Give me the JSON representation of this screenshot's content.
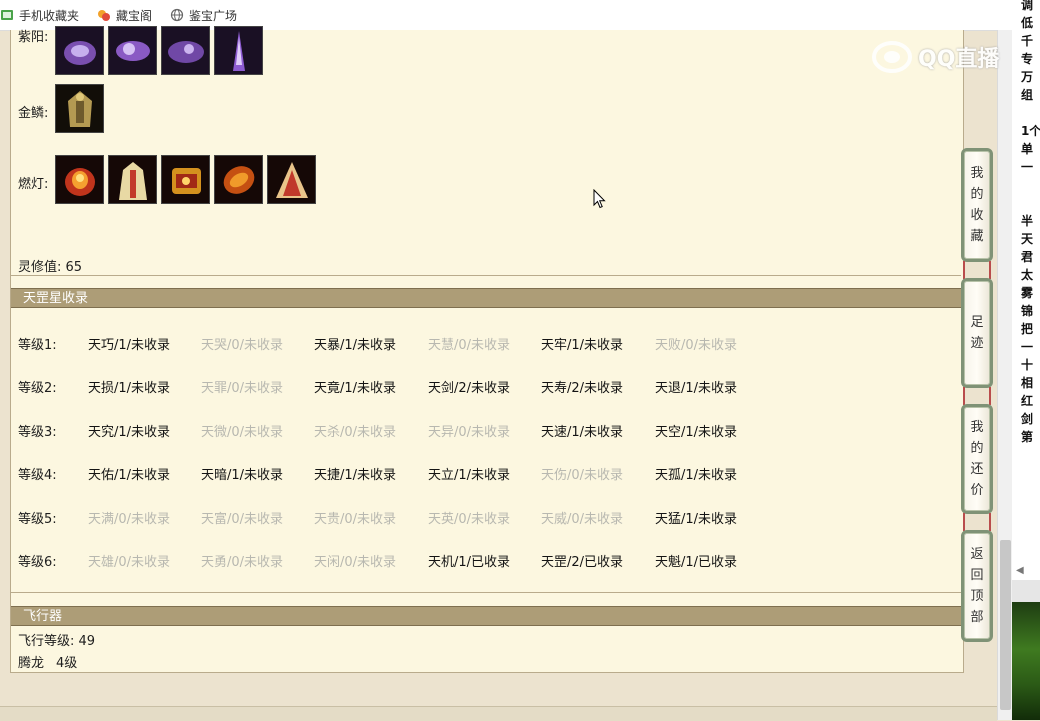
{
  "bookmarks": [
    {
      "label": "手机收藏夹",
      "icon": "phone-folder-icon"
    },
    {
      "label": "藏宝阁",
      "icon": "treasure-pavilion-icon"
    },
    {
      "label": "鉴宝广场",
      "icon": "globe-icon"
    }
  ],
  "equipment": {
    "ziyang_label": "紫阳:",
    "jinlin_label": "金鳞:",
    "randeng_label": "燃灯:",
    "lingxiu": "灵修值: 65"
  },
  "tiangang": {
    "title": "天罡星收录",
    "rows": [
      {
        "label": "等级1:",
        "cells": [
          {
            "text": "天巧/1/未收录",
            "on": true
          },
          {
            "text": "天哭/0/未收录",
            "on": false
          },
          {
            "text": "天暴/1/未收录",
            "on": true
          },
          {
            "text": "天慧/0/未收录",
            "on": false
          },
          {
            "text": "天牢/1/未收录",
            "on": true
          },
          {
            "text": "天败/0/未收录",
            "on": false
          }
        ]
      },
      {
        "label": "等级2:",
        "cells": [
          {
            "text": "天损/1/未收录",
            "on": true
          },
          {
            "text": "天罪/0/未收录",
            "on": false
          },
          {
            "text": "天竟/1/未收录",
            "on": true
          },
          {
            "text": "天剑/2/未收录",
            "on": true
          },
          {
            "text": "天寿/2/未收录",
            "on": true
          },
          {
            "text": "天退/1/未收录",
            "on": true
          }
        ]
      },
      {
        "label": "等级3:",
        "cells": [
          {
            "text": "天究/1/未收录",
            "on": true
          },
          {
            "text": "天微/0/未收录",
            "on": false
          },
          {
            "text": "天杀/0/未收录",
            "on": false
          },
          {
            "text": "天异/0/未收录",
            "on": false
          },
          {
            "text": "天速/1/未收录",
            "on": true
          },
          {
            "text": "天空/1/未收录",
            "on": true
          }
        ]
      },
      {
        "label": "等级4:",
        "cells": [
          {
            "text": "天佑/1/未收录",
            "on": true
          },
          {
            "text": "天暗/1/未收录",
            "on": true
          },
          {
            "text": "天捷/1/未收录",
            "on": true
          },
          {
            "text": "天立/1/未收录",
            "on": true
          },
          {
            "text": "天伤/0/未收录",
            "on": false
          },
          {
            "text": "天孤/1/未收录",
            "on": true
          }
        ]
      },
      {
        "label": "等级5:",
        "cells": [
          {
            "text": "天满/0/未收录",
            "on": false
          },
          {
            "text": "天富/0/未收录",
            "on": false
          },
          {
            "text": "天贵/0/未收录",
            "on": false
          },
          {
            "text": "天英/0/未收录",
            "on": false
          },
          {
            "text": "天威/0/未收录",
            "on": false
          },
          {
            "text": "天猛/1/未收录",
            "on": true
          }
        ]
      },
      {
        "label": "等级6:",
        "cells": [
          {
            "text": "天雄/0/未收录",
            "on": false
          },
          {
            "text": "天勇/0/未收录",
            "on": false
          },
          {
            "text": "天闲/0/未收录",
            "on": false
          },
          {
            "text": "天机/1/已收录",
            "on": true
          },
          {
            "text": "天罡/2/已收录",
            "on": true
          },
          {
            "text": "天魁/1/已收录",
            "on": true
          }
        ]
      }
    ]
  },
  "aircraft": {
    "title": "飞行器",
    "level": "飞行等级: 49",
    "mount_name": "腾龙",
    "mount_level": "4级"
  },
  "side_nav": [
    {
      "chars": [
        "我",
        "的",
        "收",
        "藏"
      ]
    },
    {
      "chars": [
        "足",
        "迹"
      ]
    },
    {
      "chars": [
        "我",
        "的",
        "还",
        "价"
      ]
    },
    {
      "chars": [
        "返",
        "回",
        "顶",
        "部"
      ]
    }
  ],
  "right_strip": [
    "调",
    "低",
    "千",
    "专",
    "万",
    "组",
    "1个",
    "单",
    "一",
    "半",
    "天",
    "君",
    "太",
    "雾",
    "锦",
    "把",
    "一",
    "十",
    "相",
    "红",
    "剑",
    "第"
  ],
  "watermark": "QQ直播",
  "colors": {
    "section_bg": "#ad9d77",
    "panel_bg": "#fcf7e0",
    "inactive_text": "#b8b8b0"
  }
}
